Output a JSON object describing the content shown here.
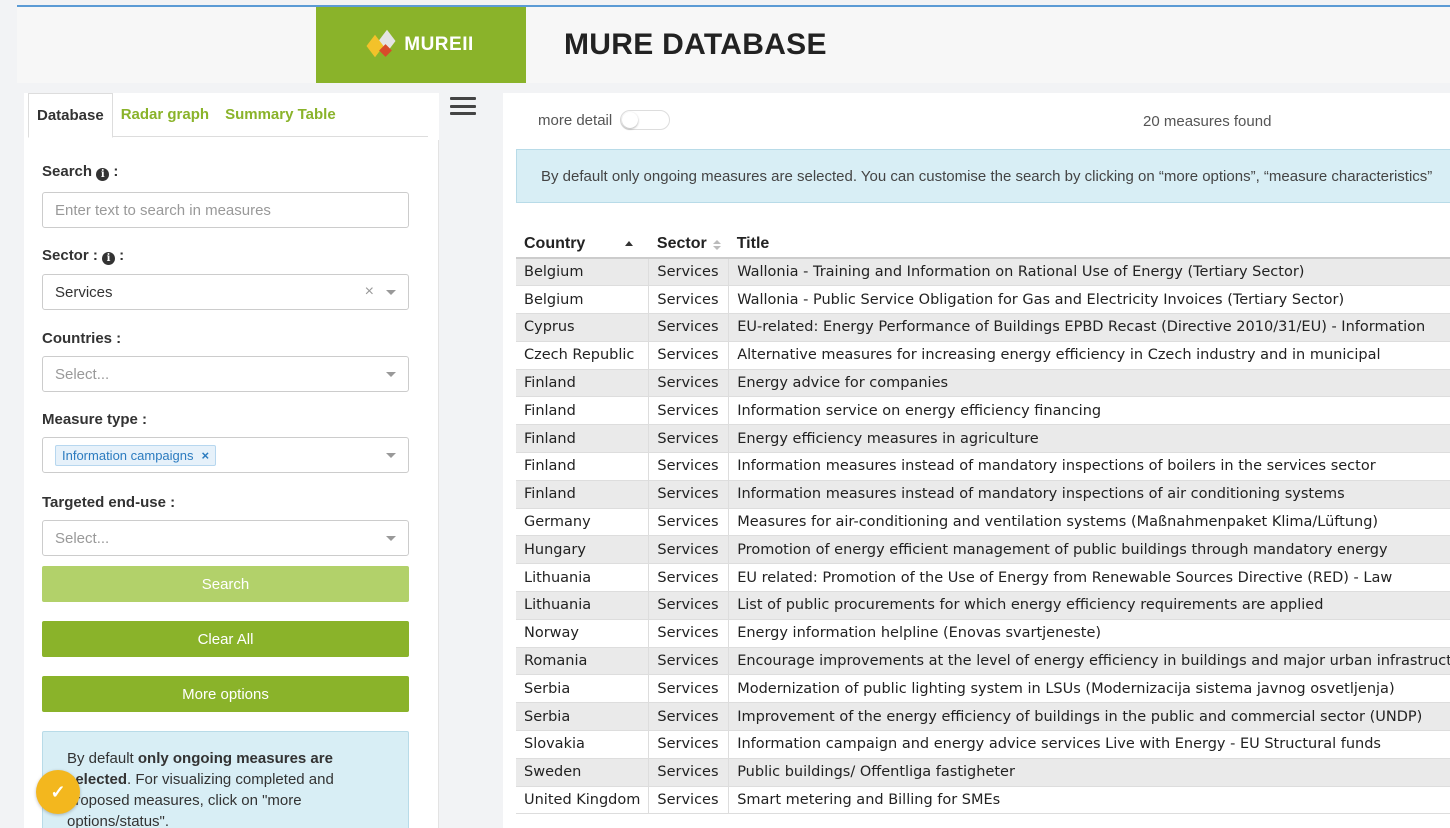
{
  "app": {
    "logo_text": "MUREII",
    "title": "MURE DATABASE"
  },
  "sidebar": {
    "tabs": [
      {
        "label": "Database",
        "active": true
      },
      {
        "label": "Radar graph",
        "active": false
      },
      {
        "label": "Summary Table",
        "active": false
      }
    ],
    "search": {
      "label": "Search",
      "placeholder": "Enter text to search in measures"
    },
    "sector": {
      "label": "Sector :",
      "value": "Services",
      "clear": "×"
    },
    "countries": {
      "label": "Countries :",
      "placeholder": "Select..."
    },
    "measure_type": {
      "label": "Measure type :",
      "tag": "Information campaigns",
      "tag_remove": "×"
    },
    "end_use": {
      "label": "Targeted end-use :",
      "placeholder": "Select..."
    },
    "buttons": {
      "search": "Search",
      "clear_all": "Clear All",
      "more_options": "More options"
    },
    "notice": {
      "pre": "By default ",
      "bold1": "only ongoing measures are selected",
      "mid": ". For visualizing completed and proposed measures, click on \"more options/status\"."
    }
  },
  "main": {
    "more_detail_label": "more detail",
    "more_detail_on": false,
    "results_count": "20 measures found",
    "info_banner": "By default only ongoing measures are selected. You can customise the search by clicking on “more options”, “measure characteristics”",
    "table": {
      "columns": [
        "Country",
        "Sector",
        "Title"
      ],
      "rows": [
        [
          "Belgium",
          "Services",
          "Wallonia - Training and Information on Rational Use of Energy (Tertiary Sector)"
        ],
        [
          "Belgium",
          "Services",
          "Wallonia - Public Service Obligation for Gas and Electricity Invoices (Tertiary Sector)"
        ],
        [
          "Cyprus",
          "Services",
          "EU-related: Energy Performance of Buildings EPBD Recast (Directive 2010/31/EU) - Information"
        ],
        [
          "Czech Republic",
          "Services",
          "Alternative measures for increasing energy efficiency in Czech industry and in municipal"
        ],
        [
          "Finland",
          "Services",
          "Energy advice for companies"
        ],
        [
          "Finland",
          "Services",
          "Information service on energy efficiency financing"
        ],
        [
          "Finland",
          "Services",
          "Energy efficiency measures in agriculture"
        ],
        [
          "Finland",
          "Services",
          "Information measures instead of mandatory inspections of boilers in the services sector"
        ],
        [
          "Finland",
          "Services",
          "Information measures instead of mandatory inspections of air conditioning systems"
        ],
        [
          "Germany",
          "Services",
          "Measures for air-conditioning and ventilation systems (Maßnahmenpaket Klima/Lüftung)"
        ],
        [
          "Hungary",
          "Services",
          "Promotion of energy efficient management of public buildings through mandatory energy"
        ],
        [
          "Lithuania",
          "Services",
          "EU related: Promotion of the Use of Energy from Renewable Sources Directive (RED) - Law"
        ],
        [
          "Lithuania",
          "Services",
          "List of public procurements for which energy efficiency requirements are applied"
        ],
        [
          "Norway",
          "Services",
          "Energy information helpline (Enovas svartjeneste)"
        ],
        [
          "Romania",
          "Services",
          "Encourage improvements at the level of energy efficiency in buildings and major urban infrastructure"
        ],
        [
          "Serbia",
          "Services",
          "Modernization of public lighting system in LSUs (Modernizacija sistema javnog osvetljenja)"
        ],
        [
          "Serbia",
          "Services",
          "Improvement of the energy efficiency of buildings in the public and commercial sector (UNDP)"
        ],
        [
          "Slovakia",
          "Services",
          "Information campaign and energy advice services Live with Energy - EU Structural funds"
        ],
        [
          "Sweden",
          "Services",
          "Public buildings/ Offentliga fastigheter"
        ],
        [
          "United Kingdom",
          "Services",
          "Smart metering and Billing for SMEs"
        ]
      ]
    }
  },
  "colors": {
    "brand_green": "#8ab32a",
    "brand_green_light": "#b2d16a",
    "info_blue_bg": "#d8eef5",
    "tag_blue": "#2b7bbf",
    "fab_yellow": "#f3b71e"
  },
  "icons": {
    "info": "info-circle-icon",
    "menu": "hamburger-menu-icon",
    "fab": "checkmark-badge-icon"
  }
}
